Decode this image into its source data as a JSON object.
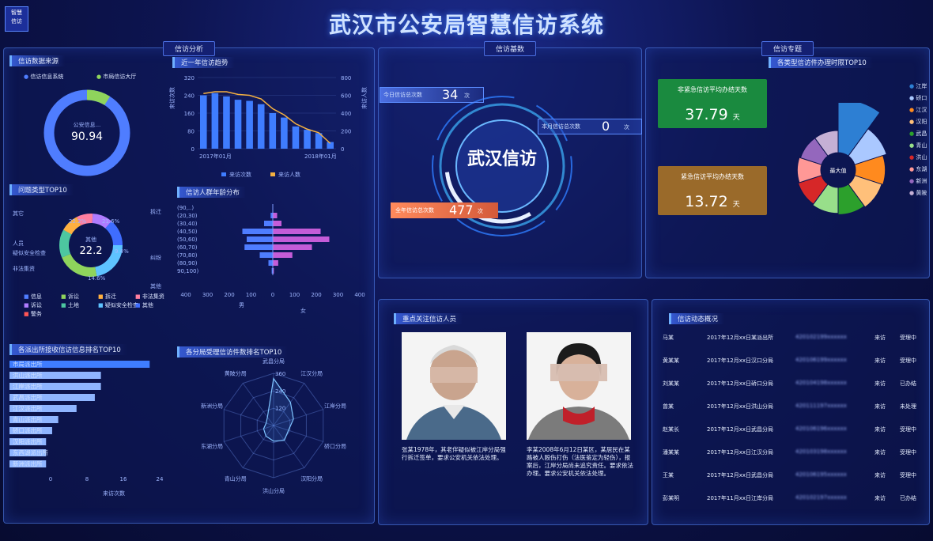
{
  "title": "武汉市公安局智慧信访系统",
  "badge": [
    "智慧",
    "信访"
  ],
  "sections": {
    "analysis": "信访分析",
    "basic": "信访基数",
    "special": "信访专题"
  },
  "source": {
    "title": "信访数据来源",
    "legend": [
      {
        "label": "信访信息系统",
        "color": "#4f7dff"
      },
      {
        "label": "市局信访大厅",
        "color": "#8fd45c"
      }
    ],
    "center_label": "公安信息...",
    "center_value": "90.94"
  },
  "trend": {
    "title": "近一年信访趋势",
    "y_left_label": "来访次数",
    "y_right_label": "来访人数",
    "y_left_ticks": [
      "320",
      "240",
      "160",
      "80",
      "0"
    ],
    "y_right_ticks": [
      "800",
      "600",
      "400",
      "200",
      "0"
    ],
    "x_labels": [
      "2017年01月",
      "2018年01月"
    ],
    "legend": [
      "来访次数",
      "来访人数"
    ]
  },
  "issue": {
    "title": "问题类型TOP10",
    "center_label": "其他",
    "center_value": "22.2",
    "pct_labels": [
      "22.2%",
      "21.6%",
      "9.4%",
      "14.6%"
    ],
    "outer_labels": [
      "其它",
      "拆迁",
      "纠纷",
      "人员",
      "疑似安全检查",
      "非法集资",
      "其他"
    ],
    "legend": [
      "信息",
      "诉讼",
      "拆迁",
      "非法集资",
      "诉讼",
      "土地",
      "疑似安全检查",
      "其他",
      "警务"
    ]
  },
  "age": {
    "title": "信访人群年龄分布",
    "groups": [
      "(90,..)",
      "(20,30)",
      "(30,40)",
      "(40,50)",
      "(50,60)",
      "(60,70)",
      "(70,80)",
      "(80,90)",
      "90,100)"
    ],
    "x_ticks": [
      "400",
      "300",
      "200",
      "100",
      "0",
      "100",
      "200",
      "300",
      "400"
    ],
    "male_label": "男",
    "female_label": "女"
  },
  "bureau": {
    "title": "各派出所接收信访信息排名TOP10",
    "items": [
      "市局派出所",
      "洪山派出所",
      "江岸派出所",
      "武昌派出所",
      "江汉派出所",
      "青山派出所",
      "硚口派出所",
      "汉阳派出所",
      "东西湖派出所",
      "新洲派出所"
    ],
    "x_ticks": [
      "0",
      "8",
      "16",
      "24"
    ],
    "legend": "来访次数"
  },
  "radar": {
    "title": "各分局受理信访件数排名TOP10",
    "axes": [
      "武昌分局",
      "江汉分局",
      "江岸分局",
      "硚口分局",
      "汉阳分局",
      "洪山分局",
      "青山分局",
      "东湖分局",
      "新洲分局",
      "黄陂分局"
    ],
    "ticks": [
      "360",
      "240",
      "120"
    ]
  },
  "center": {
    "label": "武汉信访",
    "today_label": "今日信访总次数",
    "today_value": "34",
    "today_unit": "次",
    "month_label": "本月信访总次数",
    "month_value": "0",
    "month_unit": "次",
    "year_label": "全年信访总次数",
    "year_value": "477",
    "year_unit": "次"
  },
  "special": {
    "top_title": "各类型信访件办理时限TOP10",
    "kpi1_title": "非紧急信访平均办结天数",
    "kpi1_value": "37.79",
    "kpi1_unit": "天",
    "kpi2_title": "紧急信访平均办结天数",
    "kpi2_value": "13.72",
    "kpi2_unit": "天",
    "pie_center_label": "最大值",
    "legend": [
      "江岸",
      "硚口",
      "江汉",
      "汉阳",
      "武昌",
      "青山",
      "洪山",
      "东湖",
      "新洲",
      "黄陂"
    ]
  },
  "persons": {
    "title": "重点关注信访人员",
    "p1_desc": "张某1978年，其老伴疑似被江岸分局强行拆迁签单，要求公安机关依法处理。",
    "p2_desc": "李某2008年6月12日某区，某居民在某路被人殴伤打伤（法医鉴定为轻伤），报案后，江岸分局尚未追究责任。要求依法办理。要求公安机关依法处理。"
  },
  "dynamics": {
    "title": "信访动态概况",
    "rows": [
      [
        "马某",
        "2017年12月xx日",
        "某派出所",
        "420102199xxxxxx",
        "来访",
        "受理中"
      ],
      [
        "黄某某",
        "2017年12月xx日",
        "汉口分局",
        "420106199xxxxxx",
        "来访",
        "受理中"
      ],
      [
        "刘某某",
        "2017年12月xx日",
        "硚口分局",
        "420104198xxxxxx",
        "来访",
        "已办结"
      ],
      [
        "曾某",
        "2017年12月xx日",
        "洪山分局",
        "420111197xxxxxx",
        "来访",
        "未处理"
      ],
      [
        "赵某长",
        "2017年12月xx日",
        "武昌分局",
        "420106196xxxxxx",
        "来访",
        "受理中"
      ],
      [
        "潘某某",
        "2017年12月xx日",
        "江汉分局",
        "420103198xxxxxx",
        "来访",
        "受理中"
      ],
      [
        "王某",
        "2017年12月xx日",
        "武昌分局",
        "420106195xxxxxx",
        "来访",
        "受理中"
      ],
      [
        "彭某明",
        "2017年11月xx日",
        "江岸分局",
        "420102197xxxxxx",
        "来访",
        "已办结"
      ]
    ]
  },
  "chart_data": [
    {
      "type": "pie",
      "title": "信访数据来源",
      "categories": [
        "信访信息系统",
        "市局信访大厅"
      ],
      "values": [
        90.94,
        9.06
      ]
    },
    {
      "type": "bar",
      "title": "近一年信访趋势",
      "categories": [
        "2017年01月",
        "02",
        "03",
        "04",
        "05",
        "06",
        "07",
        "08",
        "09",
        "10",
        "11",
        "2018年01月"
      ],
      "series": [
        {
          "name": "来访次数",
          "values": [
            240,
            250,
            235,
            220,
            215,
            200,
            160,
            140,
            100,
            85,
            70,
            30
          ]
        },
        {
          "name": "来访人数",
          "values": [
            620,
            640,
            640,
            610,
            600,
            560,
            450,
            380,
            280,
            220,
            180,
            60
          ]
        }
      ],
      "ylim": [
        0,
        320
      ]
    },
    {
      "type": "bar",
      "title": "信访人群年龄分布",
      "categories": [
        "(90,..)",
        "(20,30)",
        "(30,40)",
        "(40,50)",
        "(50,60)",
        "(60,70)",
        "(70,80)",
        "(80,90)",
        "90,100)"
      ],
      "series": [
        {
          "name": "男",
          "values": [
            0,
            10,
            40,
            140,
            120,
            130,
            60,
            20,
            5
          ]
        },
        {
          "name": "女",
          "values": [
            0,
            20,
            40,
            220,
            260,
            180,
            90,
            25,
            5
          ]
        }
      ]
    },
    {
      "type": "bar",
      "title": "各派出所接收信访信息排名TOP10",
      "categories": [
        "市局派出所",
        "洪山派出所",
        "江岸派出所",
        "武昌派出所",
        "江汉派出所",
        "青山派出所",
        "硚口派出所",
        "汉阳派出所",
        "东西湖派出所",
        "新洲派出所"
      ],
      "values": [
        23,
        15,
        15,
        14,
        11,
        8,
        7,
        6,
        6,
        6
      ],
      "xlim": [
        0,
        24
      ]
    },
    {
      "type": "pie",
      "title": "各类型信访件办理时限TOP10",
      "categories": [
        "江岸",
        "硚口",
        "江汉",
        "汉阳",
        "武昌",
        "青山",
        "洪山",
        "东湖",
        "新洲",
        "黄陂"
      ],
      "values": [
        30,
        14,
        11,
        10,
        9,
        8,
        7,
        6,
        5,
        5
      ]
    }
  ]
}
